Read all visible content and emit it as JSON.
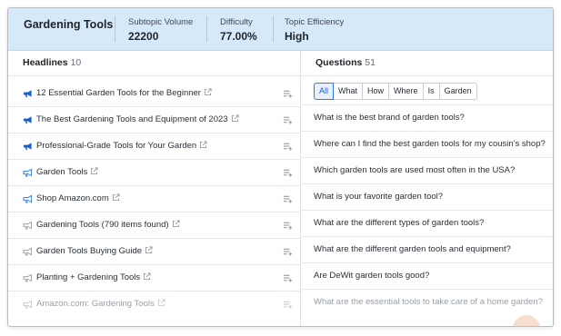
{
  "header": {
    "title": "Gardening Tools",
    "metrics": [
      {
        "label": "Subtopic Volume",
        "value": "22200"
      },
      {
        "label": "Difficulty",
        "value": "77.00%"
      },
      {
        "label": "Topic Efficiency",
        "value": "High"
      }
    ]
  },
  "headlines": {
    "title": "Headlines",
    "count": "10",
    "items": [
      {
        "text": "12 Essential Garden Tools for the Beginner",
        "level": "high"
      },
      {
        "text": "The Best Gardening Tools and Equipment of 2023",
        "level": "high"
      },
      {
        "text": "Professional-Grade Tools for Your Garden",
        "level": "high"
      },
      {
        "text": "Garden Tools",
        "level": "medium"
      },
      {
        "text": "Shop Amazon.com",
        "level": "medium"
      },
      {
        "text": "Gardening Tools (790 items found)",
        "level": "low"
      },
      {
        "text": "Garden Tools Buying Guide",
        "level": "low"
      },
      {
        "text": "Planting + Gardening Tools",
        "level": "low"
      },
      {
        "text": "Amazon.com: Gardening Tools",
        "level": "low"
      }
    ]
  },
  "questions": {
    "title": "Questions",
    "count": "51",
    "filters": [
      "All",
      "What",
      "How",
      "Where",
      "Is",
      "Garden"
    ],
    "active_filter": "All",
    "items": [
      "What is the best brand of garden tools?",
      "Where can I find the best garden tools for my cousin's shop?",
      "Which garden tools are used most often in the USA?",
      "What is your favorite garden tool?",
      "What are the different types of garden tools?",
      "What are the different garden tools and equipment?",
      "Are DeWit garden tools good?",
      "What are the essential tools to take care of a home garden?"
    ]
  },
  "colors": {
    "header_bg": "#d6e9fb",
    "accent": "#2f7be6",
    "megaphone_high": "#1a5fc7",
    "megaphone_medium": "#2f7be6",
    "megaphone_low": "#9aa0a8"
  },
  "icons": {
    "headline": "megaphone-icon",
    "link": "external-link-icon",
    "add": "add-to-list-icon"
  }
}
